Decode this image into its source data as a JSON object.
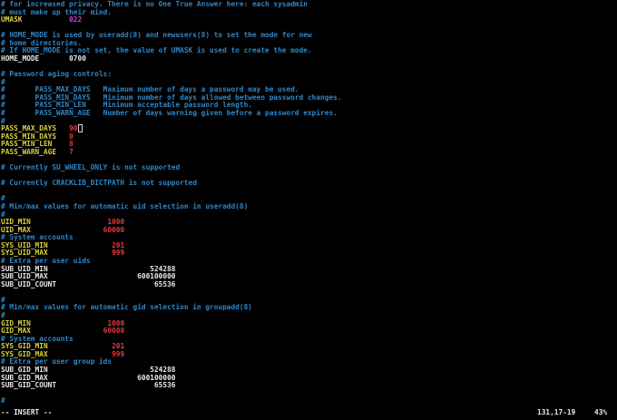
{
  "colors": {
    "background": "#000000",
    "comment": "#2f86c6",
    "keyword": "#d8cf3e",
    "plain": "#e8e8e8",
    "number": "#e03b3b",
    "octal": "#d044d0"
  },
  "lines": [
    [
      {
        "t": "# for increased privacy. There is no One True Answer here: each sysadmin",
        "c": "c"
      }
    ],
    [
      {
        "t": "# must make up their mind.",
        "c": "c"
      }
    ],
    [
      {
        "t": "UMASK           ",
        "c": "y"
      },
      {
        "t": "022",
        "c": "m"
      }
    ],
    [],
    [
      {
        "t": "# HOME_MODE is used by useradd(8) and newusers(8) to set the mode for new",
        "c": "c"
      }
    ],
    [
      {
        "t": "# home directories.",
        "c": "c"
      }
    ],
    [
      {
        "t": "# If HOME_MODE is not set, the value of UMASK is used to create the mode.",
        "c": "c"
      }
    ],
    [
      {
        "t": "HOME_MODE       0700",
        "c": "w"
      }
    ],
    [],
    [
      {
        "t": "# Password aging controls:",
        "c": "c"
      }
    ],
    [
      {
        "t": "#",
        "c": "c"
      }
    ],
    [
      {
        "t": "#       PASS_MAX_DAYS   Maximum number of days a password may be used.",
        "c": "c"
      }
    ],
    [
      {
        "t": "#       PASS_MIN_DAYS   Minimum number of days allowed between password changes.",
        "c": "c"
      }
    ],
    [
      {
        "t": "#       PASS_MIN_LEN    Minimum acceptable password length.",
        "c": "c"
      }
    ],
    [
      {
        "t": "#       PASS_WARN_AGE   Number of days warning given before a password expires.",
        "c": "c"
      }
    ],
    [
      {
        "t": "#",
        "c": "c"
      }
    ],
    [
      {
        "t": "PASS_MAX_DAYS   ",
        "c": "y"
      },
      {
        "t": "90",
        "c": "r"
      },
      {
        "t": "",
        "c": "cursor"
      }
    ],
    [
      {
        "t": "PASS_MIN_DAYS   ",
        "c": "y"
      },
      {
        "t": "0",
        "c": "r"
      }
    ],
    [
      {
        "t": "PASS_MIN_LEN    ",
        "c": "y"
      },
      {
        "t": "8",
        "c": "r"
      }
    ],
    [
      {
        "t": "PASS_WARN_AGE   ",
        "c": "y"
      },
      {
        "t": "7",
        "c": "r"
      }
    ],
    [],
    [
      {
        "t": "# Currently SU_WHEEL_ONLY is not supported",
        "c": "c"
      }
    ],
    [],
    [
      {
        "t": "# Currently CRACKLIB_DICTPATH is not supported",
        "c": "c"
      }
    ],
    [],
    [
      {
        "t": "#",
        "c": "c"
      }
    ],
    [
      {
        "t": "# Min/max values for automatic uid selection in useradd(8)",
        "c": "c"
      }
    ],
    [
      {
        "t": "#",
        "c": "c"
      }
    ],
    [
      {
        "t": "UID_MIN                  ",
        "c": "y"
      },
      {
        "t": "1000",
        "c": "r"
      }
    ],
    [
      {
        "t": "UID_MAX                 ",
        "c": "y"
      },
      {
        "t": "60000",
        "c": "r"
      }
    ],
    [
      {
        "t": "# System accounts",
        "c": "c"
      }
    ],
    [
      {
        "t": "SYS_UID_MIN               ",
        "c": "y"
      },
      {
        "t": "201",
        "c": "r"
      }
    ],
    [
      {
        "t": "SYS_UID_MAX               ",
        "c": "y"
      },
      {
        "t": "999",
        "c": "r"
      }
    ],
    [
      {
        "t": "# Extra per user uids",
        "c": "c"
      }
    ],
    [
      {
        "t": "SUB_UID_MIN                        524288",
        "c": "w"
      }
    ],
    [
      {
        "t": "SUB_UID_MAX                     600100000",
        "c": "w"
      }
    ],
    [
      {
        "t": "SUB_UID_COUNT                       65536",
        "c": "w"
      }
    ],
    [],
    [
      {
        "t": "#",
        "c": "c"
      }
    ],
    [
      {
        "t": "# Min/max values for automatic gid selection in groupadd(8)",
        "c": "c"
      }
    ],
    [
      {
        "t": "#",
        "c": "c"
      }
    ],
    [
      {
        "t": "GID_MIN                  ",
        "c": "y"
      },
      {
        "t": "1000",
        "c": "r"
      }
    ],
    [
      {
        "t": "GID_MAX                 ",
        "c": "y"
      },
      {
        "t": "60000",
        "c": "r"
      }
    ],
    [
      {
        "t": "# System accounts",
        "c": "c"
      }
    ],
    [
      {
        "t": "SYS_GID_MIN               ",
        "c": "y"
      },
      {
        "t": "201",
        "c": "r"
      }
    ],
    [
      {
        "t": "SYS_GID_MAX               ",
        "c": "y"
      },
      {
        "t": "999",
        "c": "r"
      }
    ],
    [
      {
        "t": "# Extra per user group ids",
        "c": "c"
      }
    ],
    [
      {
        "t": "SUB_GID_MIN                        524288",
        "c": "w"
      }
    ],
    [
      {
        "t": "SUB_GID_MAX                     600100000",
        "c": "w"
      }
    ],
    [
      {
        "t": "SUB_GID_COUNT                       65536",
        "c": "w"
      }
    ],
    [],
    [
      {
        "t": "#",
        "c": "c"
      }
    ]
  ],
  "status": {
    "mode": "-- INSERT --",
    "position": "131,17-19",
    "percent": "43%"
  }
}
